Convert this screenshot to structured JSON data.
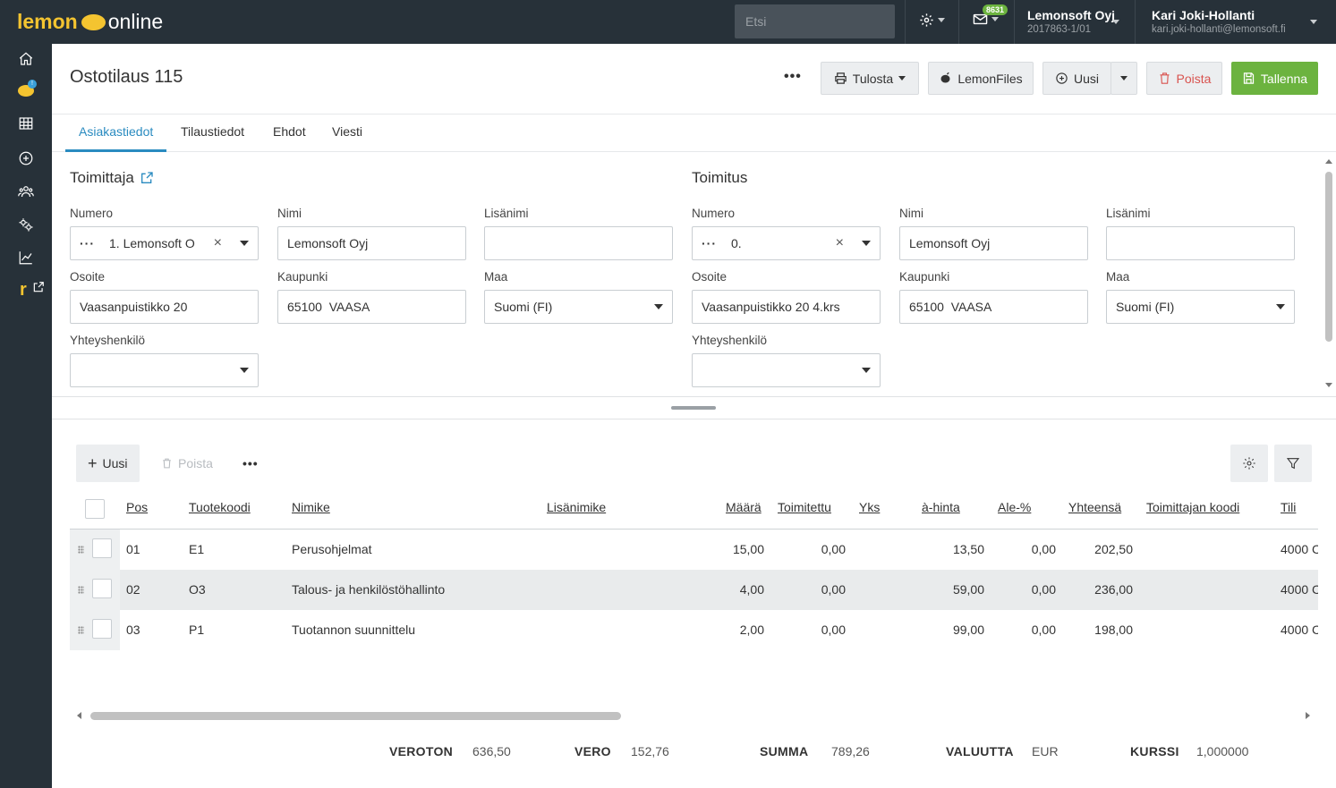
{
  "topbar": {
    "logo_left": "lemon",
    "logo_right": "online",
    "search_placeholder": "Etsi",
    "message_count": "8631",
    "company_name": "Lemonsoft Oyj",
    "company_id": "2017863-1/01",
    "user_name": "Kari Joki-Hollanti",
    "user_email": "kari.joki-hollanti@lemonsoft.fi"
  },
  "sidebar": {
    "lemon_badge": "!",
    "r_label": "r"
  },
  "header": {
    "title": "Ostotilaus 115",
    "more": "•••",
    "print_label": "Tulosta",
    "lemonfiles_label": "LemonFiles",
    "new_label": "Uusi",
    "delete_label": "Poista",
    "save_label": "Tallenna"
  },
  "tabs": [
    {
      "label": "Asiakastiedot"
    },
    {
      "label": "Tilaustiedot"
    },
    {
      "label": "Ehdot"
    },
    {
      "label": "Viesti"
    }
  ],
  "supplier": {
    "title": "Toimittaja",
    "number_label": "Numero",
    "number_value": "1. Lemonsoft O",
    "name_label": "Nimi",
    "name_value": "Lemonsoft Oyj",
    "extra_name_label": "Lisänimi",
    "extra_name_value": "",
    "address_label": "Osoite",
    "address_value": "Vaasanpuistikko 20",
    "city_label": "Kaupunki",
    "city_value": "65100  VAASA",
    "country_label": "Maa",
    "country_value": "Suomi (FI)",
    "contact_label": "Yhteyshenkilö",
    "contact_value": ""
  },
  "delivery": {
    "title": "Toimitus",
    "number_label": "Numero",
    "number_value": "0.",
    "name_label": "Nimi",
    "name_value": "Lemonsoft Oyj",
    "extra_name_label": "Lisänimi",
    "extra_name_value": "",
    "address_label": "Osoite",
    "address_value": "Vaasanpuistikko 20 4.krs",
    "city_label": "Kaupunki",
    "city_value": "65100  VAASA",
    "country_label": "Maa",
    "country_value": "Suomi (FI)",
    "contact_label": "Yhteyshenkilö",
    "contact_value": ""
  },
  "rows_toolbar": {
    "new_label": "Uusi",
    "delete_label": "Poista",
    "more": "•••"
  },
  "table": {
    "columns": [
      "Pos",
      "Tuotekoodi",
      "Nimike",
      "Lisänimike",
      "Määrä",
      "Toimitettu",
      "Yks",
      "à-hinta",
      "Ale-%",
      "Yhteensä",
      "Toimittajan koodi",
      "Tili"
    ],
    "rows": [
      {
        "pos": "01",
        "code": "E1",
        "name": "Perusohjelmat",
        "extra": "",
        "qty": "15,00",
        "delivered": "0,00",
        "unit": "",
        "price": "13,50",
        "discount": "0,00",
        "total": "202,50",
        "supplier_code": "",
        "account": "4000 C"
      },
      {
        "pos": "02",
        "code": "O3",
        "name": "Talous- ja henkilöstöhallinto",
        "extra": "",
        "qty": "4,00",
        "delivered": "0,00",
        "unit": "",
        "price": "59,00",
        "discount": "0,00",
        "total": "236,00",
        "supplier_code": "",
        "account": "4000 C"
      },
      {
        "pos": "03",
        "code": "P1",
        "name": "Tuotannon suunnittelu",
        "extra": "",
        "qty": "2,00",
        "delivered": "0,00",
        "unit": "",
        "price": "99,00",
        "discount": "0,00",
        "total": "198,00",
        "supplier_code": "",
        "account": "4000 C"
      }
    ]
  },
  "totals": {
    "net_label": "VEROTON",
    "net_value": "636,50",
    "tax_label": "VERO",
    "tax_value": "152,76",
    "sum_label": "SUMMA",
    "sum_value": "789,26",
    "currency_label": "VALUUTTA",
    "currency_value": "EUR",
    "rate_label": "KURSSI",
    "rate_value": "1,000000"
  },
  "colors": {
    "topbar": "#273139",
    "accent_blue": "#2a8bc0",
    "save_green": "#6cb33f",
    "lemon_yellow": "#f4c430",
    "delete_red": "#d9534f"
  }
}
